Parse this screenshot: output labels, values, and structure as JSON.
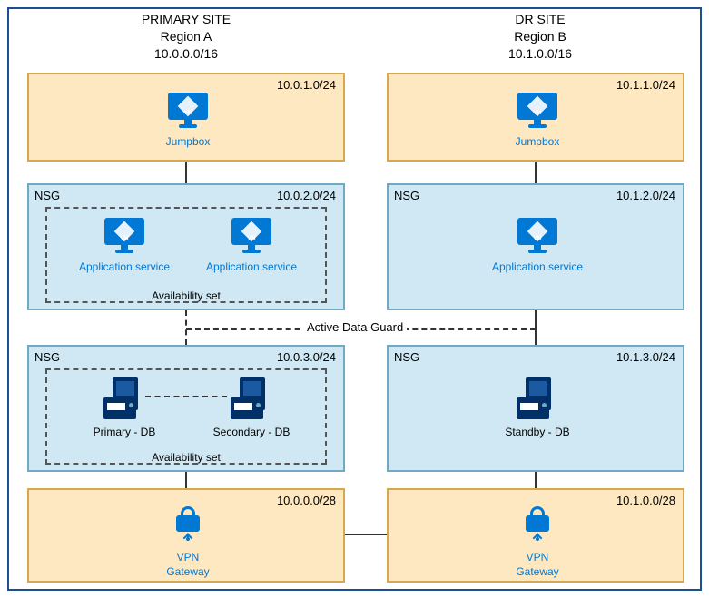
{
  "sites": {
    "primary": {
      "title": "PRIMARY SITE",
      "region": "Region A",
      "cidr": "10.0.0.0/16"
    },
    "dr": {
      "title": "DR SITE",
      "region": "Region B",
      "cidr": "10.1.0.0/16"
    }
  },
  "primary_subnets": {
    "jump": {
      "cidr": "10.0.1.0/24",
      "resource": "Jumpbox"
    },
    "app": {
      "cidr": "10.0.2.0/24",
      "nsg": "NSG",
      "avail_label": "Availability set",
      "r1": "Application service",
      "r2": "Application service"
    },
    "db": {
      "cidr": "10.0.3.0/24",
      "nsg": "NSG",
      "avail_label": "Availability set",
      "r1": "Primary - DB",
      "r2": "Secondary - DB"
    },
    "vpn": {
      "cidr": "10.0.0.0/28",
      "r1": "VPN",
      "r2": "Gateway"
    }
  },
  "dr_subnets": {
    "jump": {
      "cidr": "10.1.1.0/24",
      "resource": "Jumpbox"
    },
    "app": {
      "cidr": "10.1.2.0/24",
      "nsg": "NSG",
      "r1": "Application service"
    },
    "db": {
      "cidr": "10.1.3.0/24",
      "nsg": "NSG",
      "r1": "Standby - DB"
    },
    "vpn": {
      "cidr": "10.1.0.0/28",
      "r1": "VPN",
      "r2": "Gateway"
    }
  },
  "connection_label": "Active Data Guard"
}
